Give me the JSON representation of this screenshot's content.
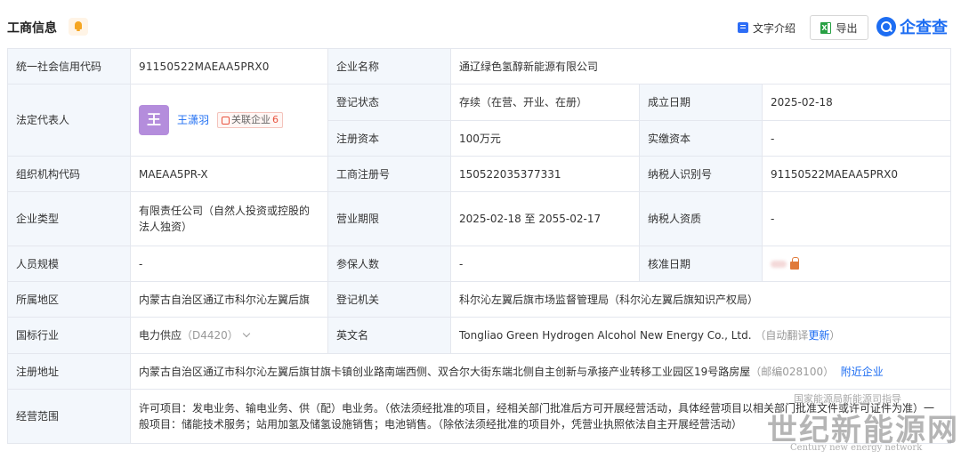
{
  "header": {
    "title": "工商信息",
    "text_intro_label": "文字介绍",
    "export_label": "导出",
    "brand": "企查查"
  },
  "rows": {
    "credit_code_label": "统一社会信用代码",
    "credit_code": "91150522MAEAA5PRX0",
    "company_name_label": "企业名称",
    "company_name": "通辽绿色氢醇新能源有限公司",
    "legal_rep_label": "法定代表人",
    "legal_rep_avatar": "王",
    "legal_rep_name": "王潇羽",
    "assoc_label": "关联企业",
    "assoc_count": "6",
    "reg_status_label": "登记状态",
    "reg_status": "存续（在营、开业、在册）",
    "established_label": "成立日期",
    "established": "2025-02-18",
    "reg_capital_label": "注册资本",
    "reg_capital": "100万元",
    "paid_capital_label": "实缴资本",
    "paid_capital": "-",
    "org_code_label": "组织机构代码",
    "org_code": "MAEAA5PR-X",
    "biz_reg_no_label": "工商注册号",
    "biz_reg_no": "150522035377331",
    "taxpayer_id_label": "纳税人识别号",
    "taxpayer_id": "91150522MAEAA5PRX0",
    "company_type_label": "企业类型",
    "company_type": "有限责任公司（自然人投资或控股的法人独资）",
    "biz_term_label": "营业期限",
    "biz_term": "2025-02-18 至 2055-02-17",
    "taxpayer_qual_label": "纳税人资质",
    "taxpayer_qual": "-",
    "staff_size_label": "人员规模",
    "staff_size": "-",
    "insured_label": "参保人数",
    "insured": "-",
    "approval_date_label": "核准日期",
    "region_label": "所属地区",
    "region": "内蒙古自治区通辽市科尔沁左翼后旗",
    "reg_authority_label": "登记机关",
    "reg_authority": "科尔沁左翼后旗市场监督管理局（科尔沁左翼后旗知识产权局）",
    "industry_label": "国标行业",
    "industry": "电力供应",
    "industry_code": "（D4420）",
    "english_name_label": "英文名",
    "english_name": "Tongliao Green Hydrogen Alcohol New Energy Co., Ltd.",
    "auto_translate": "（自动翻译",
    "update_link": "更新",
    "close_paren": "）",
    "address_label": "注册地址",
    "address": "内蒙古自治区通辽市科尔沁左翼后旗甘旗卡镇创业路南端西侧、双合尔大街东端北侧自主创新与承接产业转移工业园区19号路房屋",
    "postcode": "（邮编028100）",
    "nearby_link": "附近企业",
    "scope_label": "经营范围",
    "scope": "许可项目：发电业务、输电业务、供（配）电业务。（依法须经批准的项目，经相关部门批准后方可开展经营活动，具体经营项目以相关部门批准文件或许可证件为准）一般项目：储能技术服务；站用加氢及储氢设施销售；电池销售。（除依法须经批准的项目外，凭营业执照依法自主开展经营活动）"
  },
  "watermark": {
    "small": "国家能源局新能源司指导",
    "big": "世纪新能源网",
    "en": "Century new energy network"
  }
}
